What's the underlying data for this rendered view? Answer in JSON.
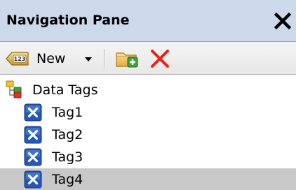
{
  "pane": {
    "title": "Navigation Pane",
    "close_icon": "close-x-icon"
  },
  "toolbar": {
    "new_label": "New",
    "new_icon": "numbered-tag-icon",
    "add_folder_icon": "add-folder-icon",
    "delete_icon": "delete-x-icon"
  },
  "tree": {
    "root": {
      "label": "Data Tags",
      "icon": "data-tags-icon"
    },
    "items": [
      {
        "label": "Tag1",
        "icon": "tag-x-icon",
        "selected": false
      },
      {
        "label": "Tag2",
        "icon": "tag-x-icon",
        "selected": false
      },
      {
        "label": "Tag3",
        "icon": "tag-x-icon",
        "selected": false
      },
      {
        "label": "Tag4",
        "icon": "tag-x-icon",
        "selected": true
      }
    ]
  },
  "colors": {
    "header_bg": "#ccd9ea",
    "selection_bg": "#c8c8c8",
    "delete_red": "#e8201a",
    "tag_icon_blue": "#2457b8"
  }
}
